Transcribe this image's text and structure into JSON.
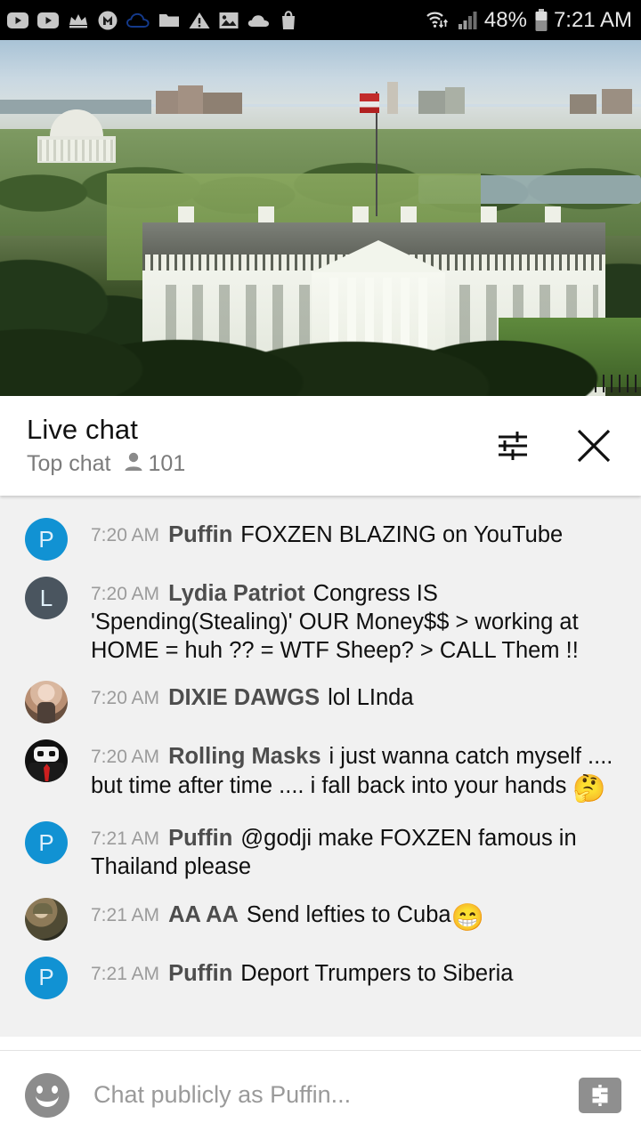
{
  "status_bar": {
    "left_icons": [
      {
        "name": "youtube-icon"
      },
      {
        "name": "youtube-icon"
      },
      {
        "name": "crown-icon"
      },
      {
        "name": "mega-m-icon"
      },
      {
        "name": "cloud-outline-icon"
      },
      {
        "name": "folder-icon"
      },
      {
        "name": "warning-triangle-icon"
      },
      {
        "name": "image-icon"
      },
      {
        "name": "cloud-icon"
      },
      {
        "name": "shopping-bag-icon"
      }
    ],
    "wifi_icon": "wifi-icon",
    "signal_icon": "cellular-signal-icon",
    "battery_percent": "48%",
    "battery_icon": "battery-icon",
    "time": "7:21 AM"
  },
  "video": {
    "label": "white-house-live-stream",
    "progress_color": "#e62117"
  },
  "chat_header": {
    "title": "Live chat",
    "subtitle": "Top chat",
    "viewer_icon": "person-icon",
    "viewer_count": "101",
    "settings_icon": "tune-settings-icon",
    "close_icon": "close-icon"
  },
  "messages": [
    {
      "time": "7:20 AM",
      "author": "Puffin",
      "text": "FOXZEN BLAZING on YouTube",
      "avatar_type": "letter",
      "avatar_letter": "P",
      "avatar_color": "#1192d3"
    },
    {
      "time": "7:20 AM",
      "author": "Lydia Patriot",
      "text": "Congress IS 'Spending(Stealing)' OUR Money$$ > working at HOME = huh ?? = WTF Sheep? > CALL Them !!",
      "avatar_type": "letter",
      "avatar_letter": "L",
      "avatar_color": "#4a555f"
    },
    {
      "time": "7:20 AM",
      "author": "DIXIE DAWGS",
      "text": "lol LInda",
      "avatar_type": "photo",
      "avatar_photo": "ph-dixie",
      "avatar_letter": "",
      "avatar_color": ""
    },
    {
      "time": "7:20 AM",
      "author": "Rolling Masks",
      "text": "i just wanna catch myself .... but time after time .... i fall back into your hands ",
      "emoji": "🤔",
      "avatar_type": "photo",
      "avatar_photo": "ph-masks",
      "avatar_letter": "",
      "avatar_color": ""
    },
    {
      "time": "7:21 AM",
      "author": "Puffin",
      "text": "@godji make FOXZEN famous in Thailand please",
      "avatar_type": "letter",
      "avatar_letter": "P",
      "avatar_color": "#1192d3"
    },
    {
      "time": "7:21 AM",
      "author": "AA AA",
      "text": "Send lefties to Cuba",
      "emoji": "😁",
      "avatar_type": "photo",
      "avatar_photo": "ph-aaaa",
      "avatar_letter": "",
      "avatar_color": ""
    },
    {
      "time": "7:21 AM",
      "author": "Puffin",
      "text": "Deport Trumpers to Siberia",
      "avatar_type": "letter",
      "avatar_letter": "P",
      "avatar_color": "#1192d3"
    }
  ],
  "input_bar": {
    "emoji_icon": "emoji-smiley-icon",
    "placeholder": "Chat publicly as Puffin...",
    "value": "",
    "superchat_icon": "dollar-superchat-icon"
  }
}
